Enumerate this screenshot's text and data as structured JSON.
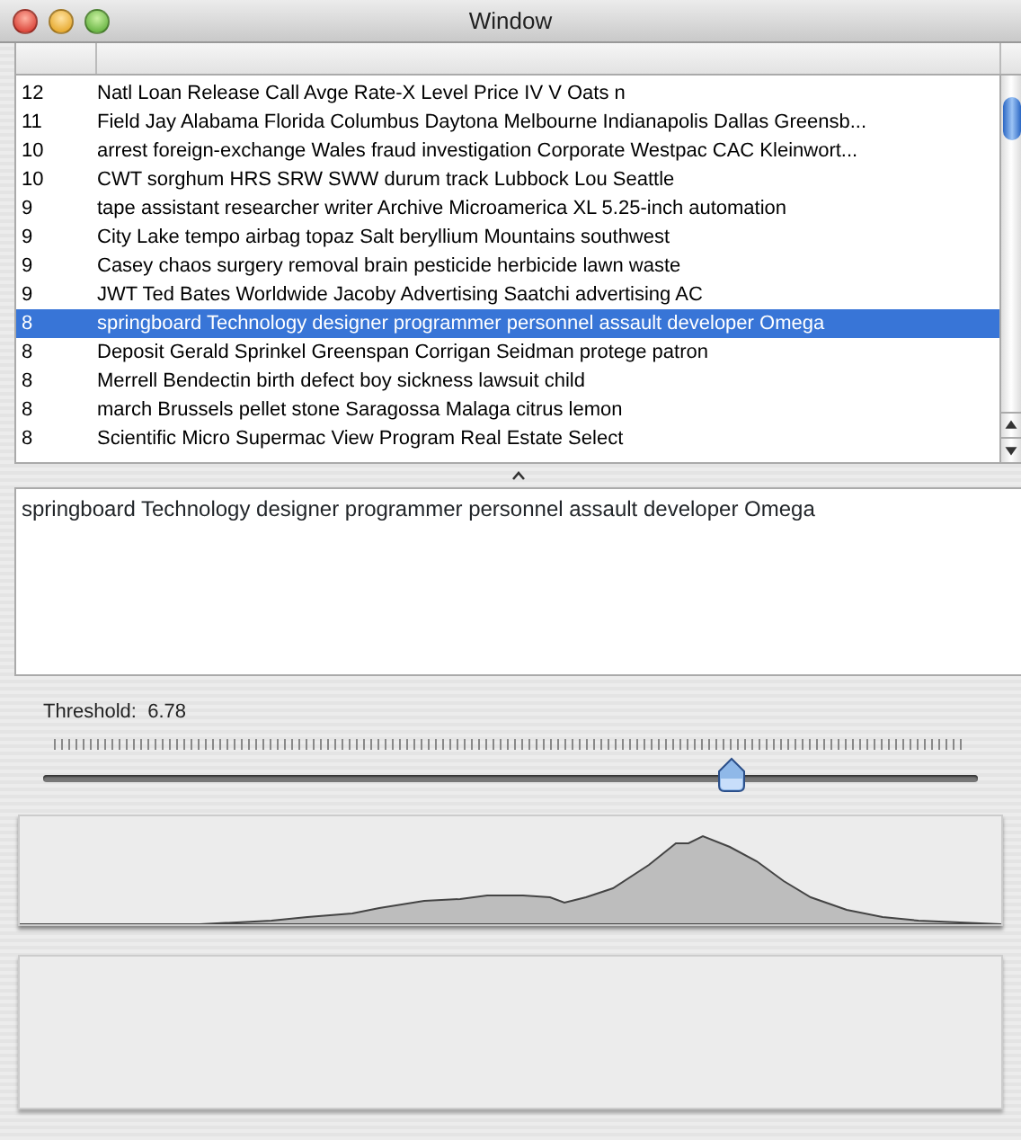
{
  "window": {
    "title": "Window"
  },
  "table": {
    "rows": [
      {
        "score": "12",
        "text": "Natl Loan Release Call Avge Rate-X Level Price IV V Oats n",
        "selected": false
      },
      {
        "score": "11",
        "text": "Field Jay Alabama Florida Columbus Daytona Melbourne Indianapolis Dallas Greensb...",
        "selected": false
      },
      {
        "score": "10",
        "text": "arrest foreign-exchange Wales fraud investigation Corporate Westpac CAC Kleinwort...",
        "selected": false
      },
      {
        "score": "10",
        "text": "CWT sorghum HRS SRW SWW durum track Lubbock Lou Seattle",
        "selected": false
      },
      {
        "score": "9",
        "text": "tape assistant researcher writer Archive Microamerica XL 5.25-inch automation",
        "selected": false
      },
      {
        "score": "9",
        "text": "City Lake tempo airbag topaz Salt beryllium Mountains southwest",
        "selected": false
      },
      {
        "score": "9",
        "text": "Casey chaos surgery removal brain pesticide herbicide lawn waste",
        "selected": false
      },
      {
        "score": "9",
        "text": "JWT Ted Bates Worldwide Jacoby Advertising Saatchi advertising AC",
        "selected": false
      },
      {
        "score": "8",
        "text": "springboard Technology designer programmer personnel assault developer Omega",
        "selected": true
      },
      {
        "score": "8",
        "text": "Deposit Gerald Sprinkel Greenspan Corrigan Seidman protege patron",
        "selected": false
      },
      {
        "score": "8",
        "text": "Merrell Bendectin birth defect boy sickness lawsuit child",
        "selected": false
      },
      {
        "score": "8",
        "text": "march Brussels pellet stone Saragossa Malaga citrus lemon",
        "selected": false
      },
      {
        "score": "8",
        "text": "Scientific Micro Supermac View Program Real Estate Select",
        "selected": false
      }
    ]
  },
  "detail": {
    "text": "springboard Technology designer programmer personnel assault developer Omega"
  },
  "threshold": {
    "label": "Threshold:",
    "value": "6.78",
    "level": 0.745
  }
}
